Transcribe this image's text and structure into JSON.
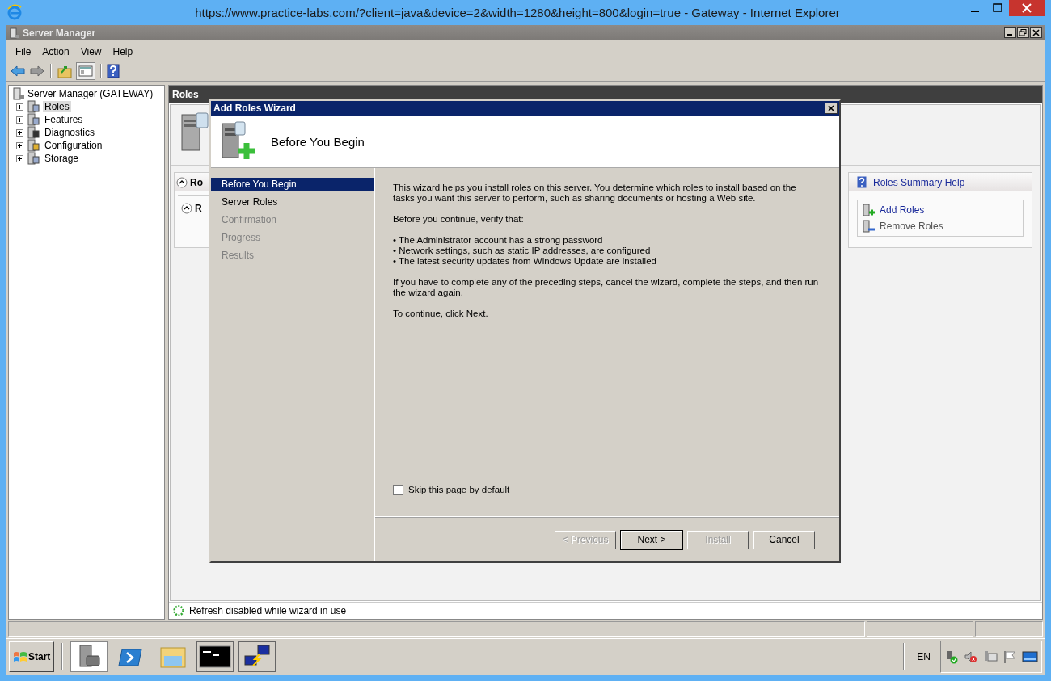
{
  "browser": {
    "title": "https://www.practice-labs.com/?client=java&device=2&width=1280&height=800&login=true - Gateway  - Internet Explorer"
  },
  "window": {
    "title": "Server Manager"
  },
  "menu": [
    "File",
    "Action",
    "View",
    "Help"
  ],
  "tree": {
    "root": "Server Manager (GATEWAY)",
    "items": [
      {
        "label": "Roles",
        "selected": true,
        "expanded": false
      },
      {
        "label": "Features",
        "selected": false,
        "expanded": false
      },
      {
        "label": "Diagnostics",
        "selected": false,
        "expanded": false
      },
      {
        "label": "Configuration",
        "selected": false,
        "expanded": false
      },
      {
        "label": "Storage",
        "selected": false,
        "expanded": false
      }
    ]
  },
  "pane": {
    "title": "Roles",
    "section_title": "Ro",
    "subsection_title": "R",
    "help_link": "Roles Summary Help",
    "tasks": [
      {
        "label": "Add Roles",
        "kind": "add",
        "disabled": false
      },
      {
        "label": "Remove Roles",
        "kind": "remove",
        "disabled": true
      }
    ],
    "status": "Refresh disabled while wizard in use"
  },
  "wizard": {
    "title": "Add Roles Wizard",
    "heading": "Before You Begin",
    "steps": [
      {
        "label": "Before You Begin",
        "selected": true,
        "disabled": false
      },
      {
        "label": "Server Roles",
        "selected": false,
        "disabled": false
      },
      {
        "label": "Confirmation",
        "selected": false,
        "disabled": true
      },
      {
        "label": "Progress",
        "selected": false,
        "disabled": true
      },
      {
        "label": "Results",
        "selected": false,
        "disabled": true
      }
    ],
    "content": [
      {
        "kind": "paragraph",
        "text": "This wizard helps you install roles on this server. You determine which roles to install based on the tasks you want this server to perform, such as sharing documents or hosting a Web site."
      },
      {
        "kind": "paragraph",
        "text": "Before you continue, verify that:"
      },
      {
        "kind": "bullets",
        "items": [
          "• The Administrator account has a strong password",
          "• Network settings, such as static IP addresses, are configured",
          "• The latest security updates from Windows Update are installed"
        ]
      },
      {
        "kind": "paragraph",
        "text": "If you have to complete any of the preceding steps, cancel the wizard, complete the steps, and then run the wizard again."
      },
      {
        "kind": "paragraph",
        "text": "To continue, click Next."
      }
    ],
    "checkbox": {
      "label": "Skip this page by default",
      "checked": false
    },
    "buttons": [
      {
        "label": "< Previous",
        "disabled": true,
        "default": false
      },
      {
        "label": "Next >",
        "disabled": false,
        "default": true
      },
      {
        "label": "Install",
        "disabled": true,
        "default": false
      },
      {
        "label": "Cancel",
        "disabled": false,
        "default": false
      }
    ]
  },
  "taskbar": {
    "start": "Start",
    "language": "EN"
  }
}
